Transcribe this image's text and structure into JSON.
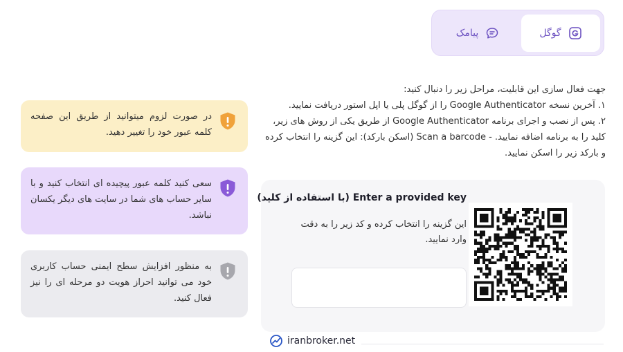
{
  "tabs": {
    "google_label": "گوگل",
    "sms_label": "پیامک",
    "google_icon": "google-g-icon",
    "sms_icon": "chat-bubble-icon"
  },
  "instructions": {
    "intro": "جهت فعال سازی این قابلیت، مراحل زیر را دنبال کنید:",
    "step1": "۱. آخرین نسخه Google Authenticator را از گوگل پلی یا اپل استور دریافت نمایید.",
    "step2": "۲. پس از نصب و اجرای برنامه Google Authenticator از طریق یکی از روش های زیر، کلید را به برنامه اضافه نمایید. - Scan a barcode (اسکن بارکد): این گزینه را انتخاب کرده و بارکد زیر را اسکن نمایید."
  },
  "card": {
    "title": "Enter a provided key (با استفاده از کلید)",
    "description": "این گزینه را انتخاب کرده و کد زیر را به دقت وارد نمایید.",
    "key_value": ""
  },
  "alerts": [
    {
      "text": "در صورت لزوم میتوانید از طریق این صفحه کلمه عبور خود را تغییر دهید.",
      "icon": "shield-warning-icon",
      "color": "#f0a23a"
    },
    {
      "text": "سعی کنید کلمه عبور پیچیده ای انتخاب کنید و با سایر حساب های شما در سایت های دیگر یکسان نباشد.",
      "icon": "shield-warning-icon",
      "color": "#8a5ad8"
    },
    {
      "text": "به منظور افزایش سطح ایمنی حساب کاربری خود می توانید احراز هویت دو مرحله ای را نیز فعال کنید.",
      "icon": "shield-warning-icon",
      "color": "#a7a7ad"
    }
  ],
  "footer": {
    "brand": "iranbroker.net",
    "brand_icon": "chart-logo-icon"
  }
}
